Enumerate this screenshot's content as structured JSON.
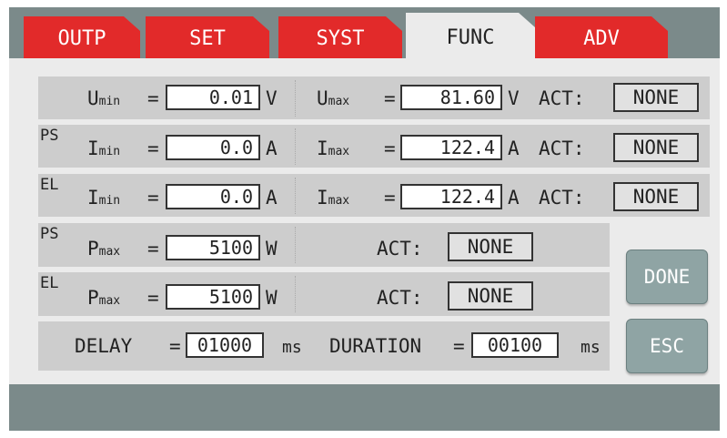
{
  "tabs": [
    {
      "label": "OUTP"
    },
    {
      "label": "SET"
    },
    {
      "label": "SYST"
    },
    {
      "label": "FUNC"
    },
    {
      "label": "ADV"
    }
  ],
  "rows": {
    "voltage": {
      "min_symbol": "U",
      "min_sub": "min",
      "min_value": "0.01",
      "min_unit": "V",
      "max_symbol": "U",
      "max_sub": "max",
      "max_value": "81.60",
      "max_unit": "V",
      "act_label": "ACT:",
      "act_value": "NONE"
    },
    "current_ps": {
      "tag": "PS",
      "min_symbol": "I",
      "min_sub": "min",
      "min_value": "0.0",
      "min_unit": "A",
      "max_symbol": "I",
      "max_sub": "max",
      "max_value": "122.4",
      "max_unit": "A",
      "act_label": "ACT:",
      "act_value": "NONE"
    },
    "current_el": {
      "tag": "EL",
      "min_symbol": "I",
      "min_sub": "min",
      "min_value": "0.0",
      "min_unit": "A",
      "max_symbol": "I",
      "max_sub": "max",
      "max_value": "122.4",
      "max_unit": "A",
      "act_label": "ACT:",
      "act_value": "NONE"
    },
    "power_ps": {
      "tag": "PS",
      "symbol": "P",
      "sub": "max",
      "value": "5100",
      "unit": "W",
      "act_label": "ACT:",
      "act_value": "NONE"
    },
    "power_el": {
      "tag": "EL",
      "symbol": "P",
      "sub": "max",
      "value": "5100",
      "unit": "W",
      "act_label": "ACT:",
      "act_value": "NONE"
    },
    "timing": {
      "delay_label": "DELAY",
      "delay_value": "01000",
      "delay_unit": "ms",
      "duration_label": "DURATION",
      "duration_value": "00100",
      "duration_unit": "ms"
    }
  },
  "eq": "=",
  "buttons": {
    "done": "DONE",
    "esc": "ESC"
  },
  "colors": {
    "tab_red": "#e22a2a",
    "panel": "#ebebeb",
    "row_bg": "#cdcdcd",
    "bezel": "#7b8a8a",
    "button": "#8fa4a4"
  }
}
